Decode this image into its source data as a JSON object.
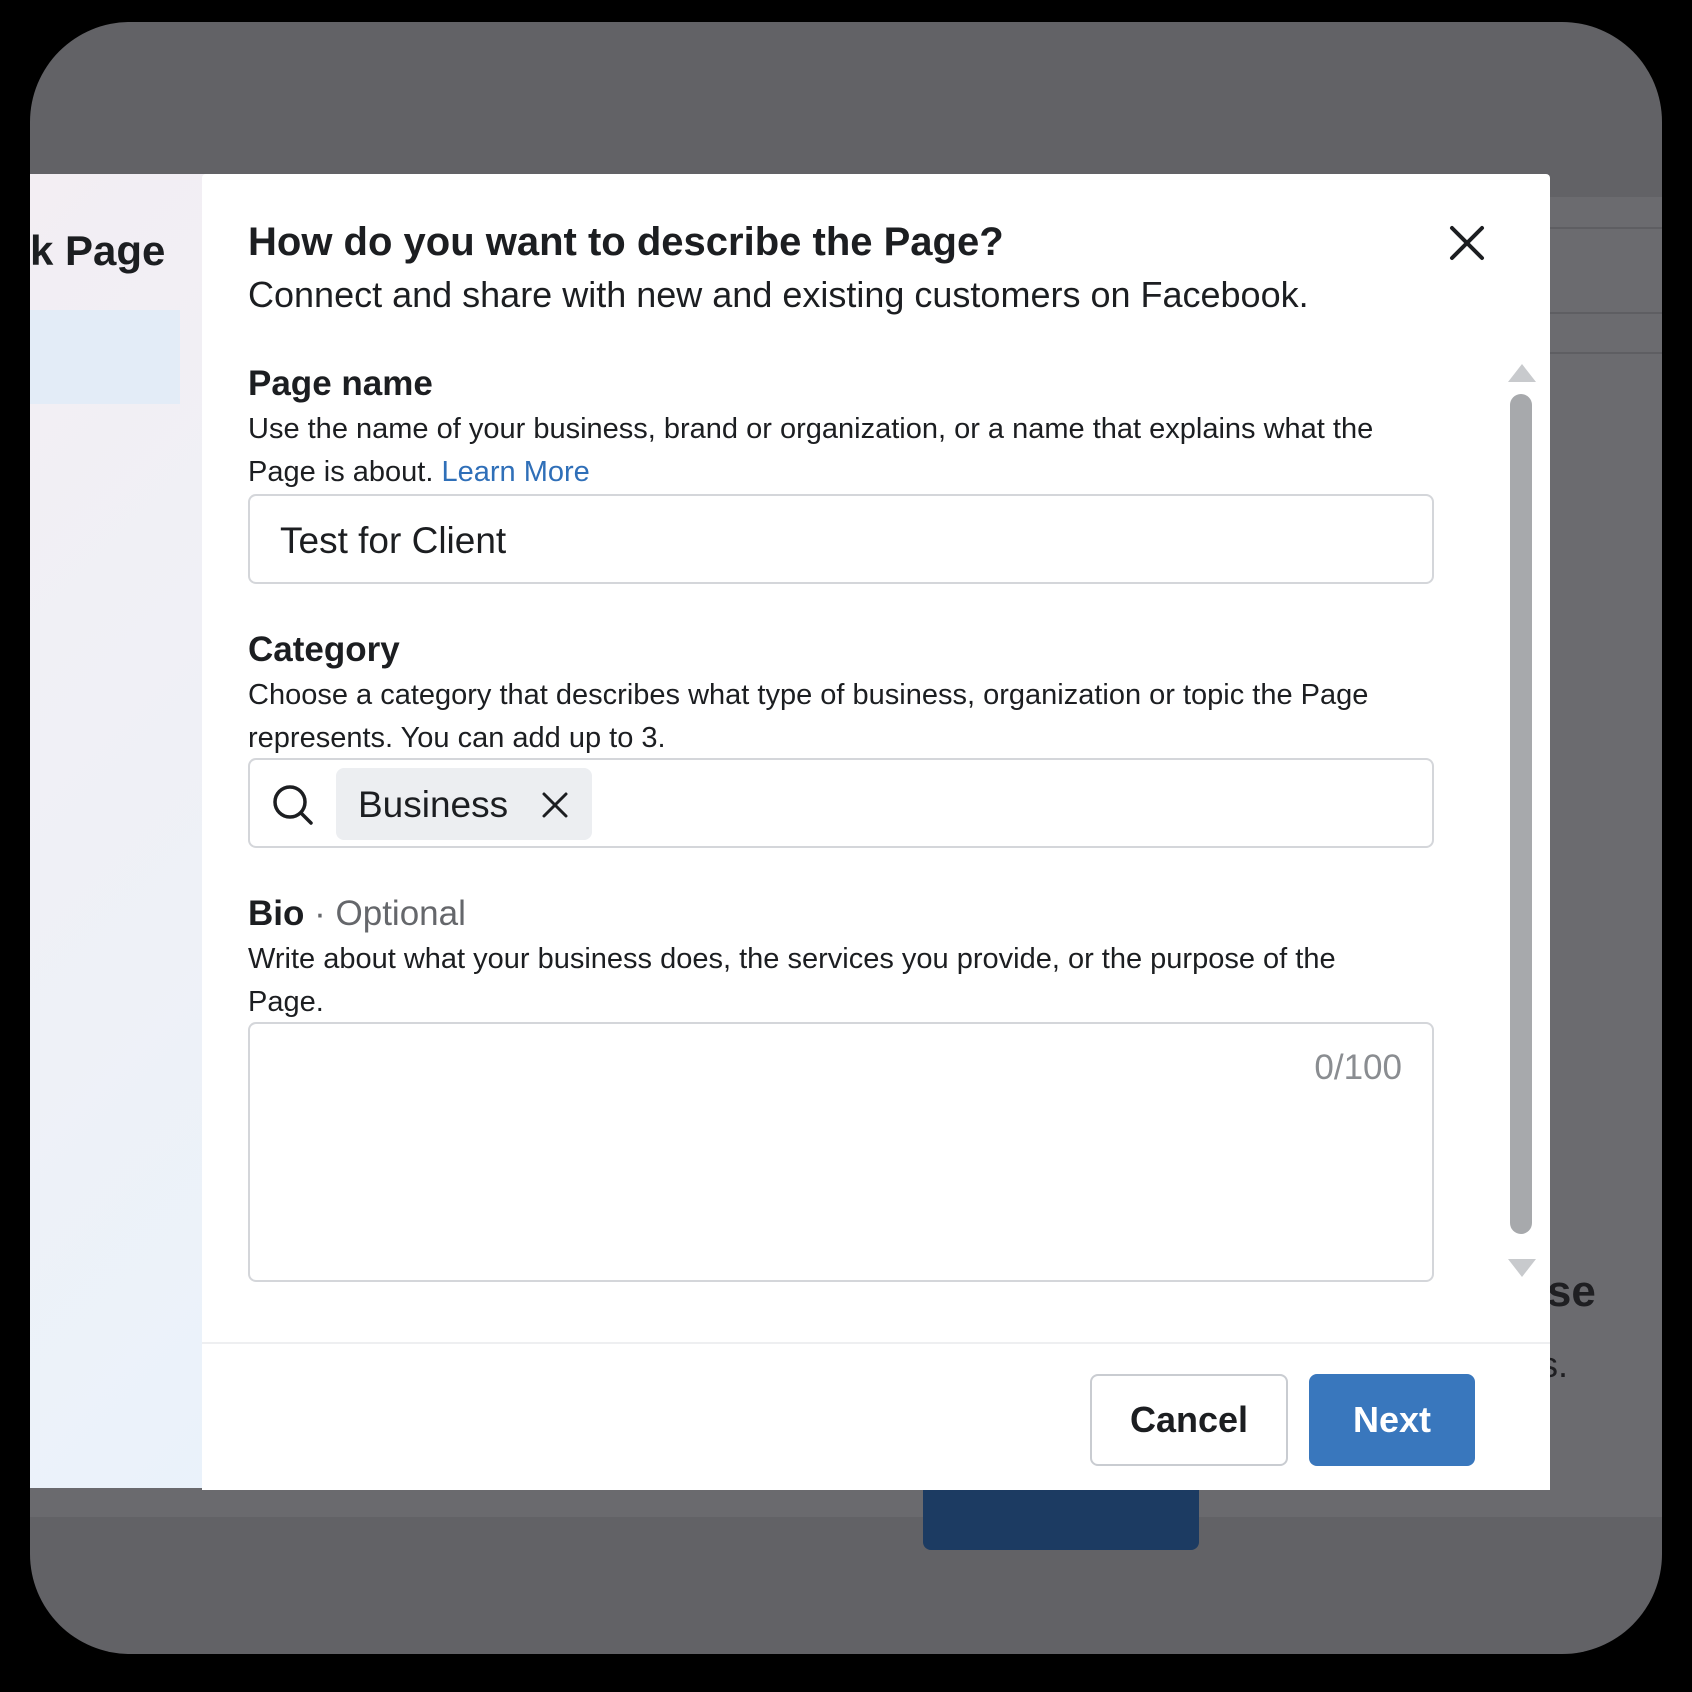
{
  "background": {
    "left_card_title": "k Page",
    "right_heading_fragment": "tise",
    "right_text_fragment": "ds."
  },
  "modal": {
    "title": "How do you want to describe the Page?",
    "subtitle": "Connect and share with new and existing customers on Facebook.",
    "close_icon": "close-icon"
  },
  "page_name": {
    "label": "Page name",
    "help": "Use the name of your business, brand or organization, or a name that explains what the Page is about.",
    "learn_more": "Learn More",
    "value": "Test for Client"
  },
  "category": {
    "label": "Category",
    "help": "Choose a category that describes what type of business, organization or topic the Page represents. You can add up to 3.",
    "search_icon": "search-icon",
    "selected_chip": "Business",
    "chip_remove_icon": "close-icon"
  },
  "bio": {
    "label": "Bio",
    "optional": "· Optional",
    "help": "Write about what your business does, the services you provide, or the purpose of the Page.",
    "counter": "0/100"
  },
  "footer": {
    "cancel_label": "Cancel",
    "next_label": "Next"
  },
  "colors": {
    "primary": "#3977bd",
    "link": "#2f6fb8",
    "text": "#1c1e21",
    "muted": "#65676b"
  }
}
